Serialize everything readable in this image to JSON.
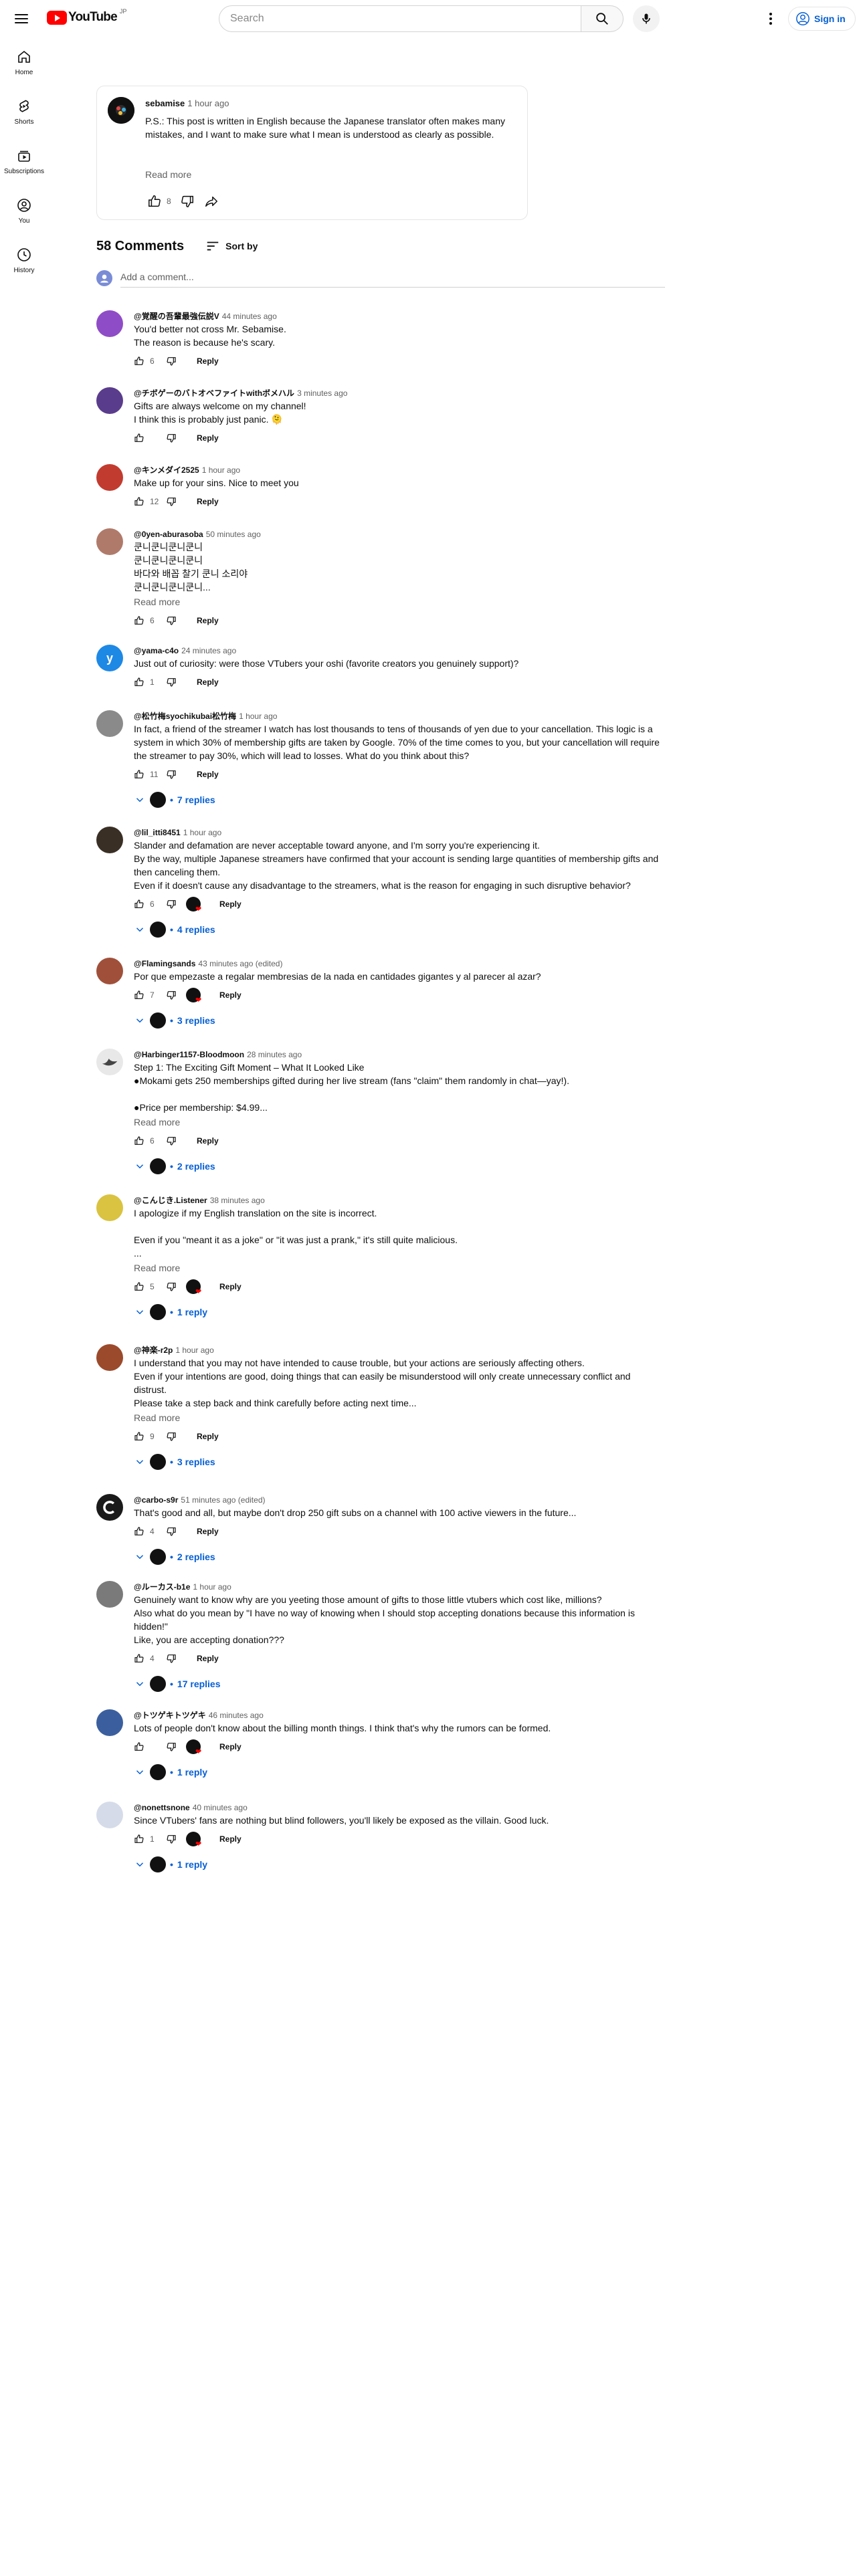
{
  "masthead": {
    "logo_text": "YouTube",
    "country_code": "JP",
    "search_placeholder": "Search",
    "sign_in_label": "Sign in"
  },
  "guide": [
    {
      "label": "Home",
      "icon": "home-icon"
    },
    {
      "label": "Shorts",
      "icon": "shorts-icon"
    },
    {
      "label": "Subscriptions",
      "icon": "subscriptions-icon"
    },
    {
      "label": "You",
      "icon": "you-icon"
    },
    {
      "label": "History",
      "icon": "history-icon"
    }
  ],
  "post": {
    "author": "sebamise",
    "time": "1 hour ago",
    "text": "P.S.: This post is written in English because the Japanese translator often makes many mistakes, and I want to make sure what I mean is understood as clearly as possible.",
    "read_more": "Read more",
    "likes": "8"
  },
  "comments_header": {
    "count": "58 Comments",
    "sort_label": "Sort by",
    "add_placeholder": "Add a comment..."
  },
  "comments": [
    {
      "author": "@覚醒の吾輩最強伝説V",
      "time": "44 minutes ago",
      "text": "You'd better not cross Mr. Sebamise.\nThe reason is because he's scary.",
      "likes": "6",
      "avatar_color": "#8f4cc7"
    },
    {
      "author": "@チボゲーのバトオベファイトwithボメハル",
      "time": "3 minutes ago",
      "text": "Gifts are always welcome on my channel!\nI think this is probably just panic. 🫠",
      "likes": "",
      "avatar_color": "#5a3c8c"
    },
    {
      "author": "@キンメダイ2525",
      "time": "1 hour ago",
      "text": "Make up for your sins. Nice to meet you",
      "likes": "12",
      "avatar_color": "#c23b2f"
    },
    {
      "author": "@0yen-aburasoba",
      "time": "50 minutes ago",
      "text": "쿤니쿤니쿤니쿤니\n쿤니쿤니쿤니쿤니\n바다와 배꼽 찰기 쿤니 소리야\n쿤니쿤니쿤니쿤니...",
      "read_more": "Read more",
      "likes": "6",
      "avatar_color": "#b07a6a"
    },
    {
      "author": "@yama-c4o",
      "time": "24 minutes ago",
      "text": "Just out of curiosity: were those VTubers your oshi (favorite creators you genuinely support)?",
      "likes": "1",
      "avatar_color": "#1e88e5",
      "avatar_letter": "y"
    },
    {
      "author": "@松竹梅syochikubai松竹梅",
      "time": "1 hour ago",
      "text": "In fact, a friend of the streamer I watch has lost thousands to tens of thousands of yen due to your cancellation. This logic is a system in which 30% of membership gifts are taken by Google. 70% of the time comes to you, but your cancellation will require the streamer to pay 30%, which will lead to losses. What do you think about this?",
      "likes": "11",
      "replies": "7 replies",
      "avatar_color": "#8a8a8a"
    },
    {
      "author": "@lil_itti8451",
      "time": "1 hour ago",
      "text": "Slander and defamation are never acceptable toward anyone, and I'm sorry you're experiencing it.\nBy the way, multiple Japanese streamers have confirmed that your account is sending large quantities of membership gifts and then canceling them.\nEven if it doesn't cause any disadvantage to the streamers, what is the reason for engaging in such disruptive behavior?",
      "likes": "6",
      "replies": "4 replies",
      "avatar_color": "#3a2f25"
    },
    {
      "author": "@Flamingsands",
      "time": "43 minutes ago (edited)",
      "text": "Por que empezaste a regalar membresias de la nada en cantidades gigantes y al parecer al azar?",
      "likes": "7",
      "replies": "3 replies",
      "avatar_color": "#a0503a"
    },
    {
      "author": "@Harbinger1157-Bloodmoon",
      "time": "28 minutes ago",
      "text": "Step 1: The Exciting Gift Moment – What It Looked Like\n●Mokami gets 250 memberships gifted during her live stream (fans \"claim\" them randomly in chat—yay!).\n\n●Price per membership: $4.99...",
      "read_more": "Read more",
      "likes": "6",
      "replies": "2 replies",
      "avatar_color": "#e8e8e8"
    },
    {
      "author": "@こんじき.Listener",
      "time": "38 minutes ago",
      "text": "I apologize if my English translation on the site is incorrect.\n\nEven if you \"meant it as a joke\" or \"it was just a prank,\" it's still quite malicious.\n...",
      "read_more": "Read more",
      "likes": "5",
      "replies": "1 reply",
      "avatar_color": "#d9c340"
    },
    {
      "author": "@神楽-r2p",
      "time": "1 hour ago",
      "text": "I understand that you may not have intended to cause trouble, but your actions are seriously affecting others.\nEven if your intentions are good, doing things that can easily be misunderstood will only create unnecessary conflict and distrust.\nPlease take a step back and think carefully before acting next time...",
      "read_more": "Read more",
      "likes": "9",
      "replies": "3 replies",
      "avatar_color": "#9b4a2c"
    },
    {
      "author": "@carbo-s9r",
      "time": "51 minutes ago (edited)",
      "text": "That's good and all, but maybe don't drop 250 gift subs on a channel with 100 active viewers in the future...",
      "likes": "4",
      "replies": "2 replies",
      "avatar_color": "#1a1a1a"
    },
    {
      "author": "@ルーカス-b1e",
      "time": "1 hour ago",
      "text": "Genuinely want to know why are you yeeting those amount of gifts to those little vtubers which cost like, millions?\nAlso what do you mean by \"I have no way of knowing when I should stop accepting donations because this information is hidden!\"\nLike, you are accepting donation???",
      "likes": "4",
      "replies": "17 replies",
      "avatar_color": "#7a7a7a"
    },
    {
      "author": "@トツゲキトツゲキ",
      "time": "46 minutes ago",
      "text": "Lots of people don't know about the billing month things. I think that's why the rumors can be formed.",
      "likes": "",
      "replies": "1 reply",
      "avatar_color": "#3b5f9e"
    },
    {
      "author": "@nonettsnone",
      "time": "40 minutes ago",
      "text": "Since VTubers' fans are nothing but blind followers, you'll likely be exposed as the villain. Good luck.",
      "likes": "1",
      "replies": "1 reply",
      "avatar_color": "#d5dbe8"
    }
  ],
  "labels": {
    "reply": "Reply"
  },
  "colors": {
    "accent_blue": "#065fd4",
    "brand_red": "#ff0000"
  }
}
